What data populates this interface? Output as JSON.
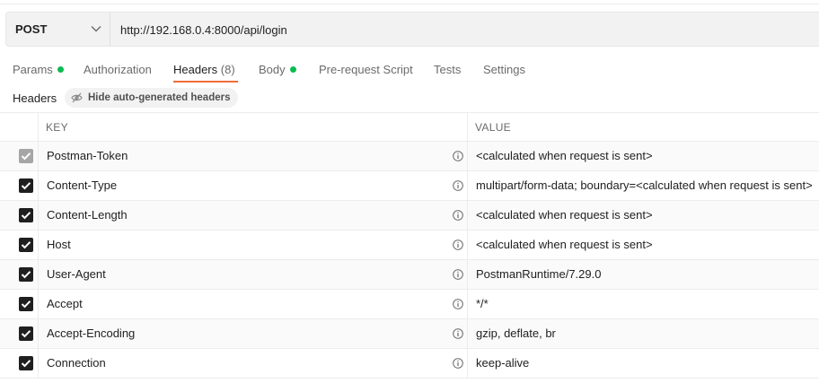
{
  "request": {
    "method": "POST",
    "url": "http://192.168.0.4:8000/api/login"
  },
  "tabs": [
    {
      "label": "Params",
      "dot": true
    },
    {
      "label": "Authorization"
    },
    {
      "label": "Headers",
      "count": "(8)",
      "active": true
    },
    {
      "label": "Body",
      "dot": true
    },
    {
      "label": "Pre-request Script"
    },
    {
      "label": "Tests"
    },
    {
      "label": "Settings"
    }
  ],
  "headers_section": {
    "label": "Headers",
    "hide_button_label": "Hide auto-generated headers"
  },
  "table": {
    "key_header": "KEY",
    "value_header": "VALUE",
    "rows": [
      {
        "key": "Postman-Token",
        "value": "<calculated when request is sent>",
        "checked": true,
        "disabled": true
      },
      {
        "key": "Content-Type",
        "value": "multipart/form-data; boundary=<calculated when request is sent>",
        "checked": true
      },
      {
        "key": "Content-Length",
        "value": "<calculated when request is sent>",
        "checked": true
      },
      {
        "key": "Host",
        "value": "<calculated when request is sent>",
        "checked": true
      },
      {
        "key": "User-Agent",
        "value": "PostmanRuntime/7.29.0",
        "checked": true
      },
      {
        "key": "Accept",
        "value": "*/*",
        "checked": true
      },
      {
        "key": "Accept-Encoding",
        "value": "gzip, deflate, br",
        "checked": true
      },
      {
        "key": "Connection",
        "value": "keep-alive",
        "checked": true
      }
    ]
  },
  "colors": {
    "accent": "#f26b3a",
    "dot_green": "#0cbb52",
    "checkbox": "#1f1f1f",
    "checkbox_disabled": "#a6a6a6"
  },
  "icons": {
    "method_dropdown": "chevron-down-icon",
    "hide_button": "eye-off-icon",
    "checkbox": "check-icon",
    "row_info": "info-icon"
  }
}
